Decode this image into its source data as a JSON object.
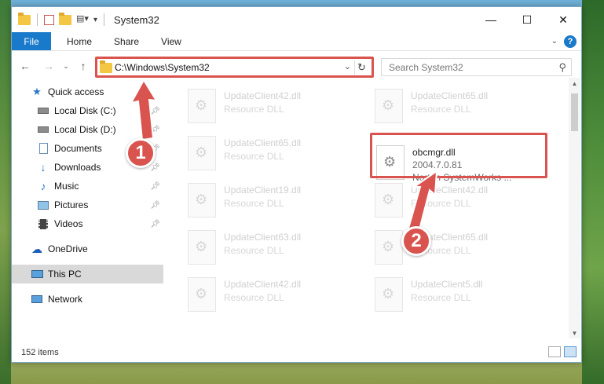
{
  "window": {
    "title": "System32",
    "controls": {
      "minimize": "—",
      "maximize": "☐",
      "close": "✕"
    }
  },
  "ribbon": {
    "file": "File",
    "tabs": [
      "Home",
      "Share",
      "View"
    ],
    "help": "?"
  },
  "address": {
    "path": "C:\\Windows\\System32",
    "search_placeholder": "Search System32"
  },
  "nav": {
    "items": [
      {
        "label": "Quick access",
        "icon": "star-icon",
        "pinned": false
      },
      {
        "label": "Local Disk (C:)",
        "icon": "drive-icon",
        "pinned": true
      },
      {
        "label": "Local Disk (D:)",
        "icon": "drive-icon",
        "pinned": true
      },
      {
        "label": "Documents",
        "icon": "documents-icon",
        "pinned": true
      },
      {
        "label": "Downloads",
        "icon": "download-icon",
        "pinned": true
      },
      {
        "label": "Music",
        "icon": "music-icon",
        "pinned": true
      },
      {
        "label": "Pictures",
        "icon": "pictures-icon",
        "pinned": true
      },
      {
        "label": "Videos",
        "icon": "videos-icon",
        "pinned": true
      },
      {
        "label": "OneDrive",
        "icon": "cloud-icon",
        "pinned": false
      },
      {
        "label": "This PC",
        "icon": "computer-icon",
        "pinned": false,
        "selected": true
      },
      {
        "label": "Network",
        "icon": "network-icon",
        "pinned": false
      }
    ]
  },
  "files": {
    "items": [
      {
        "name": "UpdateClient42.dll",
        "desc": "Resource DLL"
      },
      {
        "name": "UpdateClient65.dll",
        "desc": "Resource DLL"
      },
      {
        "name": "UpdateClient65.dll",
        "desc": "Resource DLL"
      },
      {
        "name": "UpdateClient19.dll",
        "desc": "Resource DLL"
      },
      {
        "name": "UpdateClient42.dll",
        "desc": "Resource DLL"
      },
      {
        "name": "UpdateClient63.dll",
        "desc": "Resource DLL"
      },
      {
        "name": "UpdateClient65.dll",
        "desc": "Resource DLL"
      },
      {
        "name": "UpdateClient42.dll",
        "desc": "Resource DLL"
      },
      {
        "name": "UpdateClient5.dll",
        "desc": "Resource DLL"
      }
    ],
    "highlighted": {
      "name": "obcmgr.dll",
      "version": "2004.7.0.81",
      "company": "Norton SystemWorks ..."
    }
  },
  "status": {
    "count": "152 items"
  },
  "callouts": {
    "one": "1",
    "two": "2"
  },
  "colors": {
    "accent": "#1979ca",
    "highlight_red": "#d9534f"
  }
}
